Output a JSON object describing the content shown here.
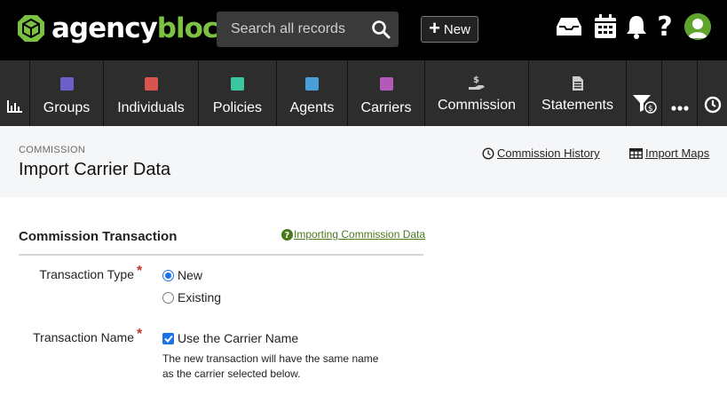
{
  "brand": {
    "name_a": "agency",
    "name_b": "bloc"
  },
  "search": {
    "placeholder": "Search all records"
  },
  "new_button": {
    "label": "New"
  },
  "top_icons": [
    "inbox-icon",
    "calendar-icon",
    "bell-icon",
    "help-icon",
    "avatar"
  ],
  "nav": {
    "items": [
      {
        "label": "Groups",
        "color": "#6c5fc7"
      },
      {
        "label": "Individuals",
        "color": "#d9534f"
      },
      {
        "label": "Policies",
        "color": "#3cc6a0"
      },
      {
        "label": "Agents",
        "color": "#4a9fd8"
      },
      {
        "label": "Carriers",
        "color": "#b35ab8"
      },
      {
        "label": "Commission",
        "icon": "hand-dollar-icon"
      },
      {
        "label": "Statements",
        "icon": "document-icon"
      }
    ]
  },
  "header": {
    "breadcrumb": "COMMISSION",
    "title": "Import Carrier Data",
    "history_link": "Commission History",
    "import_maps_link": "Import Maps"
  },
  "form": {
    "section_title": "Commission Transaction",
    "help_link": "Importing Commission Data",
    "transaction_type": {
      "label": "Transaction Type",
      "options": [
        "New",
        "Existing"
      ],
      "selected": "New"
    },
    "transaction_name": {
      "label": "Transaction Name",
      "checkbox_label": "Use the Carrier Name",
      "checked": true,
      "help_line1": "The new transaction will have the same name",
      "help_line2": "as the carrier selected below."
    }
  },
  "colors": {
    "brand_green": "#7cc242",
    "topbar": "#000000",
    "navbar": "#2d2d2d",
    "accent_blue": "#1a73e8",
    "required_red": "#c0392b"
  }
}
